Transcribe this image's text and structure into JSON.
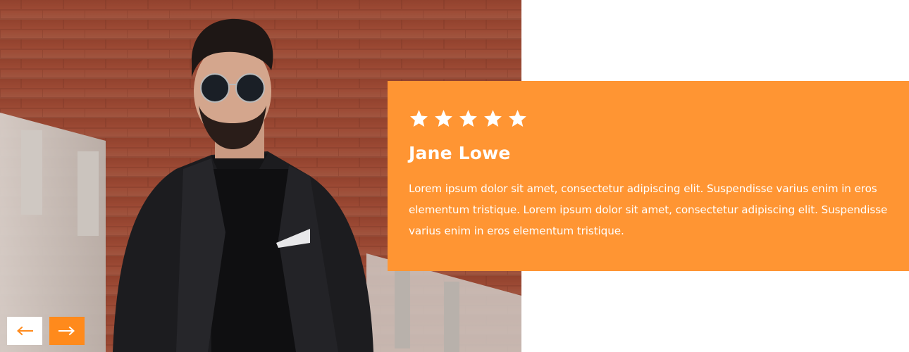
{
  "testimonial": {
    "rating": 5,
    "stars": [
      "star-icon",
      "star-icon",
      "star-icon",
      "star-icon",
      "star-icon"
    ],
    "name": "Jane Lowe",
    "quote": "Lorem ipsum dolor sit amet, consectetur adipiscing elit. Suspendisse varius enim in eros elementum tristique. Lorem ipsum dolor sit amet, consectetur adipiscing elit. Suspendisse varius enim in eros elementum tristique."
  },
  "navigation": {
    "prev_icon": "arrow-left-icon",
    "next_icon": "arrow-right-icon"
  },
  "colors": {
    "card_background": "#ff9533",
    "next_button": "#ff8a1c",
    "prev_button": "#ffffff",
    "text": "#ffffff"
  }
}
